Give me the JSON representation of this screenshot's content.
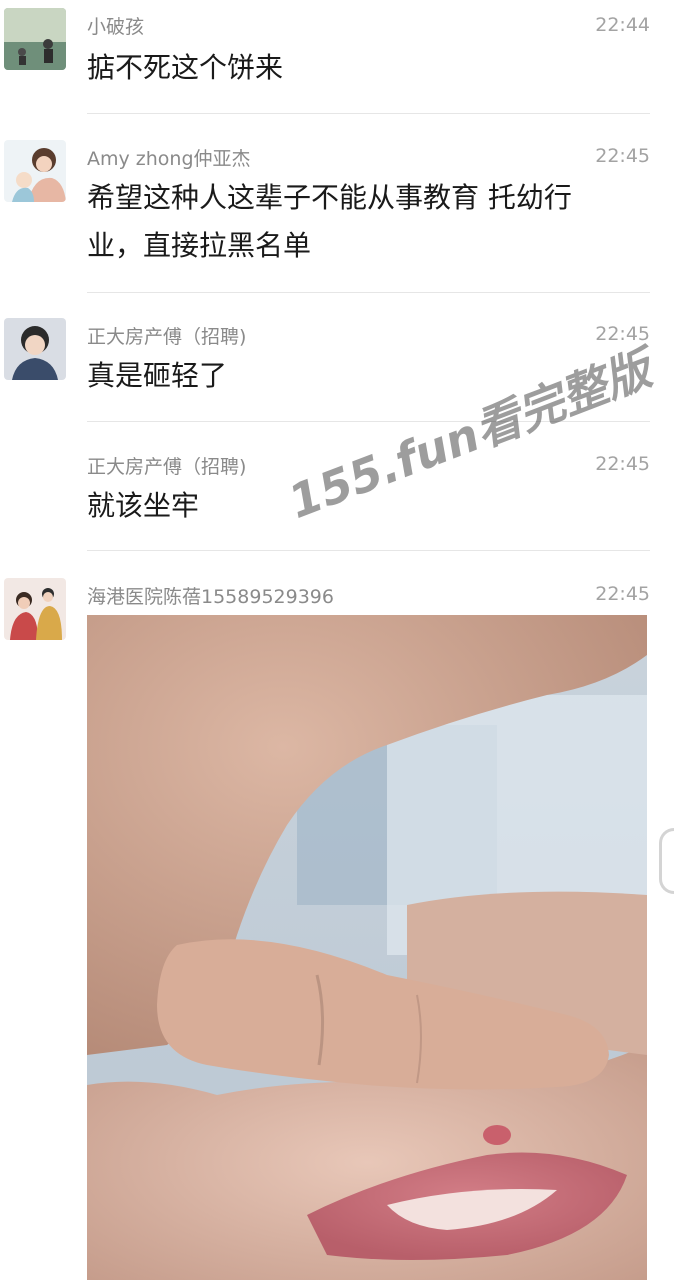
{
  "messages": [
    {
      "sender": "小破孩",
      "time": "22:44",
      "text": "掂不死这个饼来"
    },
    {
      "sender": "Amy zhong仲亚杰",
      "time": "22:45",
      "text": "希望这种人这辈子不能从事教育 托幼行业，直接拉黑名单"
    },
    {
      "sender": "正大房产傅（招聘)",
      "time": "22:45",
      "text": "真是砸轻了"
    },
    {
      "sender": "正大房产傅（招聘)",
      "time": "22:45",
      "text": "就该坐牢"
    },
    {
      "sender": "海港医院陈蓓15589529396",
      "time": "22:45",
      "image": "baby-mouth-photo"
    }
  ],
  "watermark": "155.fun看完整版",
  "colors": {
    "background": "#ffffff",
    "sender": "#8a8a8a",
    "time": "#a3a3a3",
    "text": "#1a1a1a",
    "divider": "#e6e6e6"
  }
}
